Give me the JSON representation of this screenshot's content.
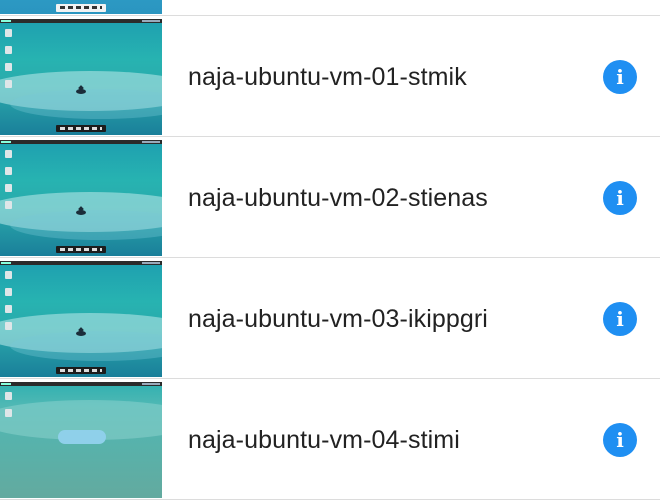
{
  "vm_list": {
    "items": [
      {
        "name": "",
        "thumbnail": "ubuntu-desktop-thumbnail",
        "info_icon": "i"
      },
      {
        "name": "naja-ubuntu-vm-01-stmik",
        "thumbnail": "ubuntu-desktop-thumbnail",
        "info_icon": "i"
      },
      {
        "name": "naja-ubuntu-vm-02-stienas",
        "thumbnail": "ubuntu-desktop-thumbnail",
        "info_icon": "i"
      },
      {
        "name": "naja-ubuntu-vm-03-ikippgri",
        "thumbnail": "ubuntu-desktop-thumbnail",
        "info_icon": "i"
      },
      {
        "name": "naja-ubuntu-vm-04-stimi",
        "thumbnail": "ubuntu-desktop-thumbnail",
        "info_icon": "i"
      }
    ]
  },
  "colors": {
    "info_icon_bg": "#1f8ff2",
    "divider": "#dcdcdc",
    "text": "#222222"
  }
}
